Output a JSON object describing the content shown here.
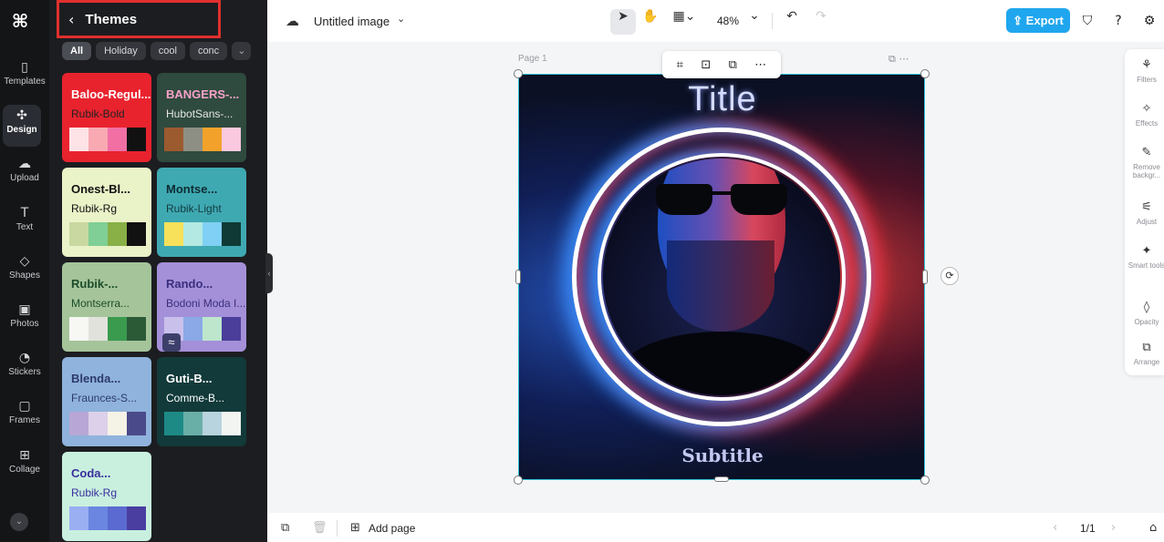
{
  "app": {
    "logo": "capcut-logo"
  },
  "rail": {
    "items": [
      {
        "label": "Templates",
        "icon": "templates-icon",
        "glyph": "▯"
      },
      {
        "label": "Design",
        "icon": "design-icon",
        "glyph": "✣"
      },
      {
        "label": "Upload",
        "icon": "upload-icon",
        "glyph": "☁"
      },
      {
        "label": "Text",
        "icon": "text-icon",
        "glyph": "T"
      },
      {
        "label": "Shapes",
        "icon": "shapes-icon",
        "glyph": "◇"
      },
      {
        "label": "Photos",
        "icon": "photos-icon",
        "glyph": "▣"
      },
      {
        "label": "Stickers",
        "icon": "stickers-icon",
        "glyph": "◔"
      },
      {
        "label": "Frames",
        "icon": "frames-icon",
        "glyph": "▢"
      },
      {
        "label": "Collage",
        "icon": "collage-icon",
        "glyph": "⊞"
      }
    ]
  },
  "panel": {
    "title": "Themes",
    "chips": [
      "All",
      "Holiday",
      "cool",
      "conc"
    ],
    "themes": [
      {
        "font1": "Baloo-Regul...",
        "font2": "Rubik-Bold",
        "bg": "#e8232e",
        "c1": "#ffffff",
        "c2": "#222222",
        "swatches": [
          "#fde3e6",
          "#f8a9b2",
          "#f26fa4",
          "#111111"
        ]
      },
      {
        "font1": "BANGERS-...",
        "font2": "HubotSans-...",
        "bg": "#2f4a3e",
        "c1": "#f8a2c8",
        "c2": "#e6e6e6",
        "swatches": [
          "#9c5a2f",
          "#8e8f84",
          "#f2a22a",
          "#fbc9df"
        ]
      },
      {
        "font1": "Onest-Bl...",
        "font2": "Rubik-Rg",
        "bg": "#eaf2c8",
        "c1": "#111111",
        "c2": "#111111",
        "swatches": [
          "#c8d8a0",
          "#7fcf96",
          "#88b046",
          "#111111"
        ]
      },
      {
        "font1": "Montse...",
        "font2": "Rubik-Light",
        "bg": "#3fa9b2",
        "c1": "#0e2d33",
        "c2": "#123c42",
        "swatches": [
          "#f7e15a",
          "#b3e9e2",
          "#7fd0f4",
          "#0f3a35"
        ]
      },
      {
        "font1": "Rubik-...",
        "font2": "Montserra...",
        "bg": "#a5c49a",
        "c1": "#1d4d2b",
        "c2": "#1d4d2b",
        "swatches": [
          "#f7f7f4",
          "#e2e2dc",
          "#3a9a4e",
          "#2b5a36"
        ]
      },
      {
        "font1": "Rando...",
        "font2": "Bodoni Moda I...",
        "bg": "#a490d8",
        "c1": "#3a2f7e",
        "c2": "#3a2f7e",
        "swatches": [
          "#c9c1ec",
          "#8aa9e6",
          "#bde6cd",
          "#4a3e9a"
        ],
        "badge": "≈"
      },
      {
        "font1": "Blenda...",
        "font2": "Fraunces-S...",
        "bg": "#8fb3dc",
        "c1": "#2d3a6e",
        "c2": "#2d3a6e",
        "swatches": [
          "#b8a7d6",
          "#ddd0ea",
          "#f5f2e6",
          "#4a4a8a"
        ]
      },
      {
        "font1": "Guti-B...",
        "font2": "Comme-B...",
        "bg": "#123a3a",
        "c1": "#ffffff",
        "c2": "#ffffff",
        "swatches": [
          "#1d8a86",
          "#6aaea8",
          "#b8d4de",
          "#f2f4f2"
        ]
      },
      {
        "font1": "Coda...",
        "font2": "Rubik-Rg",
        "bg": "#c9f0df",
        "c1": "#3a2f9e",
        "c2": "#3a2f9e",
        "swatches": [
          "#9aaef2",
          "#6a86e0",
          "#5a6ad0",
          "#4a3ea0"
        ]
      }
    ]
  },
  "topbar": {
    "doc_title": "Untitled image",
    "zoom": "48%",
    "export_label": "Export"
  },
  "canvas": {
    "page_label": "Page 1",
    "title": "Title",
    "subtitle": "Subtitle"
  },
  "props": [
    {
      "label": "Filters",
      "glyph": "⚘"
    },
    {
      "label": "Effects",
      "glyph": "✧"
    },
    {
      "label": "Remove backgr...",
      "glyph": "✎"
    },
    {
      "label": "Adjust",
      "glyph": "⚟"
    },
    {
      "label": "Smart tools",
      "glyph": "✦"
    },
    {
      "label": "Opacity",
      "glyph": "◊"
    },
    {
      "label": "Arrange",
      "glyph": "⧉"
    }
  ],
  "bottombar": {
    "add_page_label": "Add page",
    "pager": "1/1"
  }
}
